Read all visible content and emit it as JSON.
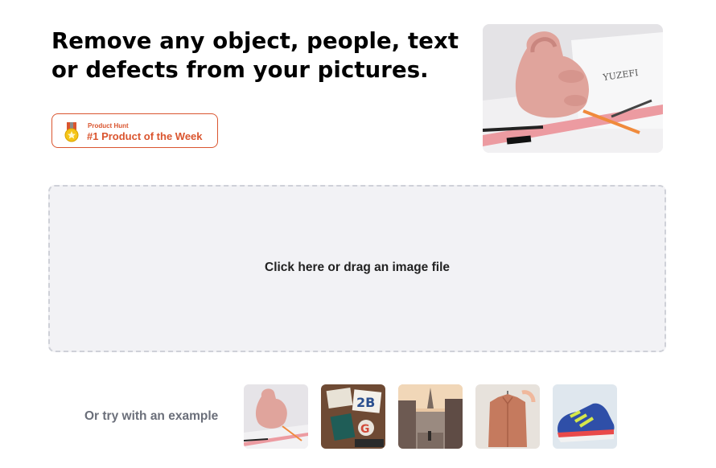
{
  "header": {
    "headline_line1": "Remove any object, people, text",
    "headline_line2": "or defects from your pictures."
  },
  "badge": {
    "small_text": "Product Hunt",
    "big_text": "#1 Product of the Week",
    "color": "#da552f",
    "icon": "medal-icon"
  },
  "hero_image": {
    "subject": "pink handbag on drafting table"
  },
  "upload": {
    "label": "Click here or drag an image file"
  },
  "examples": {
    "label": "Or try with an example",
    "items": [
      {
        "subject": "pink handbag"
      },
      {
        "subject": "desk with notebooks"
      },
      {
        "subject": "paris street with eiffel tower"
      },
      {
        "subject": "hanging orange jacket"
      },
      {
        "subject": "blue sneaker"
      }
    ]
  }
}
